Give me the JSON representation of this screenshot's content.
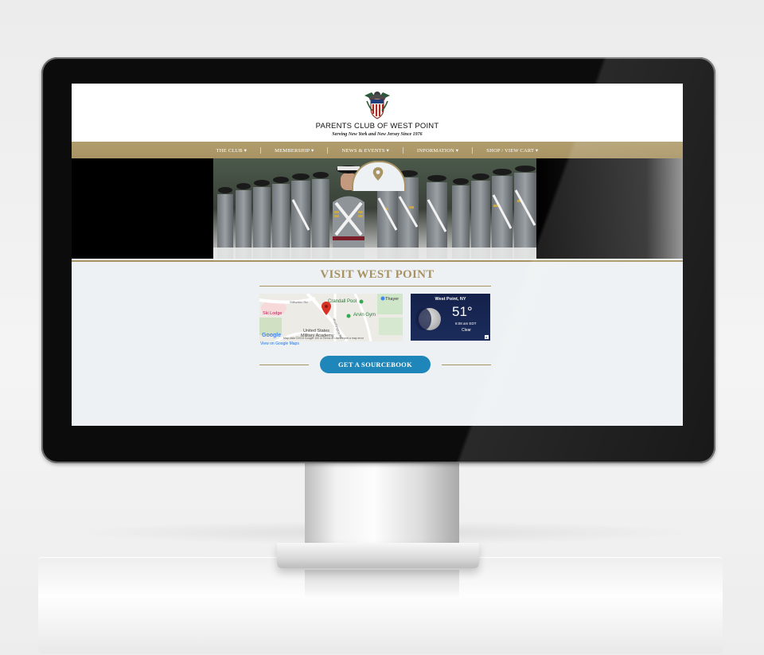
{
  "site": {
    "title": "PARENTS CLUB OF WEST POINT",
    "tagline": "Serving New York and New Jersey Since 1976"
  },
  "nav": {
    "items": [
      {
        "label": "THE CLUB ▾"
      },
      {
        "label": "MEMBERSHIP ▾"
      },
      {
        "label": "NEWS & EVENTS ▾"
      },
      {
        "label": "INFORMATION ▾",
        "active": true
      },
      {
        "label": "SHOP / VIEW CART ▾"
      }
    ]
  },
  "hero": {
    "pin_icon": "map-pin-icon"
  },
  "visit": {
    "title": "VISIT WEST POINT"
  },
  "map": {
    "labels": {
      "pool": "Crandall Pool",
      "gym": "Arvin Gym",
      "thayer": "Thayer",
      "academy_line1": "United States",
      "academy_line2": "Military Academy",
      "lodge": "Ski Lodge",
      "road1": "Stillwater Rd",
      "road2": "Washington Rd",
      "google": "Google",
      "footer": "Map data ©2019 Google   100 m        Terms of Use    Report a map error"
    },
    "caption": "View on Google Maps"
  },
  "weather": {
    "city": "West Point, NY",
    "temp": "51°",
    "time": "6:08 am EDT",
    "condition": "Clear"
  },
  "cta": {
    "label": "GET A SOURCEBOOK"
  },
  "colors": {
    "gold": "#a99364",
    "cta_blue": "#1e86b8",
    "content_bg": "#edf1f3"
  }
}
